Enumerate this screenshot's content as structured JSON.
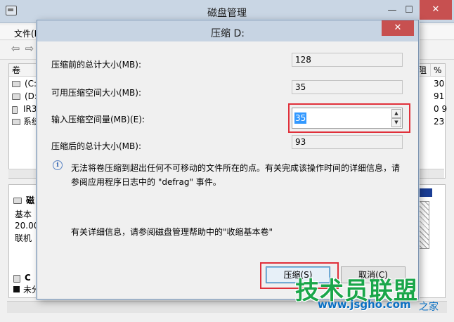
{
  "background_window": {
    "title": "磁盘管理",
    "menu_first": "文件(F",
    "table": {
      "header_first": "卷",
      "header_right": [
        "阻",
        "%"
      ],
      "rows": [
        {
          "name": "(C:",
          "value_a": "30"
        },
        {
          "name": "(D:",
          "value_a": "91"
        },
        {
          "name": "IR3",
          "value_a": "0 9"
        },
        {
          "name": "系统",
          "value_a": "23"
        }
      ]
    },
    "lower_panel": {
      "disk_label": "磁",
      "lines": [
        "基本",
        "20.00",
        "联机"
      ],
      "cd_label": "C",
      "legend": "未分"
    }
  },
  "dialog": {
    "title": "压缩 D:",
    "close_glyph": "✕",
    "fields": {
      "total_before_label": "压缩前的总计大小(MB):",
      "total_before_value": "128",
      "available_label": "可用压缩空间大小(MB):",
      "available_value": "35",
      "input_label": "输入压缩空间量(MB)(E):",
      "input_value": "35",
      "total_after_label": "压缩后的总计大小(MB):",
      "total_after_value": "93"
    },
    "info_icon": "info-icon",
    "info_text": "无法将卷压缩到超出任何不可移动的文件所在的点。有关完成该操作时间的详细信息，请参阅应用程序日志中的 \"defrag\" 事件。",
    "help_text": "有关详细信息，请参阅磁盘管理帮助中的\"收缩基本卷\"",
    "buttons": {
      "shrink": "压缩(S)",
      "cancel": "取消(C)"
    }
  },
  "watermark": {
    "brand": "技术员联盟",
    "url": "www.jsgho.com",
    "tail": "之家"
  },
  "colors": {
    "highlight_box": "#e0303a",
    "close_button": "#c75050",
    "selection": "#3399ff",
    "watermark_green": "#1aa64a"
  }
}
